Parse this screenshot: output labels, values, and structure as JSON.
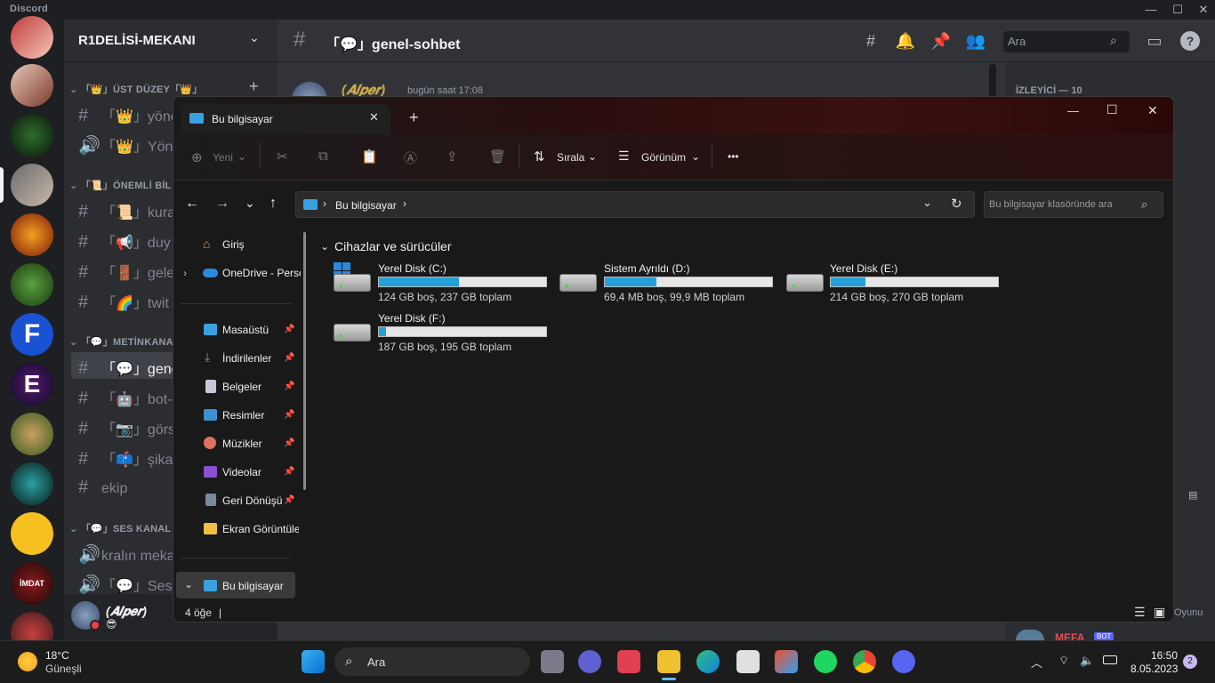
{
  "discord": {
    "brand": "Discord",
    "window_controls": {
      "minimize": "—",
      "maximize": "☐",
      "close": "✕"
    },
    "server_name": "R1DELİSİ-MEKANI",
    "categories": [
      {
        "label": "「👑」ÜST DÜZEY「👑」"
      },
      {
        "label": "「📜」ÖNEMLİ BİL"
      },
      {
        "label": "「💬」METİNKANA"
      },
      {
        "label": "「💬」SES KANAL"
      }
    ],
    "channels": [
      {
        "label": "「👑」yönet"
      },
      {
        "label": "「👑」Yönet"
      },
      {
        "label": "「📜」kura"
      },
      {
        "label": "「📢」duy"
      },
      {
        "label": "「🚪」gele"
      },
      {
        "label": "「🌈」twit"
      },
      {
        "label": "「💬」genel"
      },
      {
        "label": "「🤖」bot-"
      },
      {
        "label": "「📷」görs"
      },
      {
        "label": "「📫」şika"
      },
      {
        "label": "ekip"
      },
      {
        "label": "kralın meka"
      },
      {
        "label": "「💬」Ses"
      }
    ],
    "user": {
      "name": "(𝑨𝒍𝒑𝒆𝒓)",
      "status_emoji": "😎"
    },
    "chat": {
      "channel_title": "「💬」genel-sohbet",
      "search_placeholder": "Ara",
      "message_author": "(𝑨𝒍𝒑𝒆𝒓)",
      "message_time": "bugün saat 17:08"
    },
    "members": {
      "header": "İZLEYİCİ — 10",
      "partial_name": "MEFA",
      "bot_badge": "BOT",
      "partial_text": "Oyunu"
    }
  },
  "explorer": {
    "tab_title": "Bu bilgisayar",
    "new_tab": "+",
    "window_controls": {
      "minimize": "—",
      "maximize": "☐",
      "close": "✕"
    },
    "commands": {
      "new": "Yeni",
      "sort": "Sırala",
      "view": "Görünüm",
      "more": "•••"
    },
    "address": {
      "location": "Bu bilgisayar"
    },
    "search_placeholder": "Bu bilgisayar klasöründe ara",
    "nav": {
      "home": "Giriş",
      "onedrive": "OneDrive - Perso",
      "quick": [
        {
          "label": "Masaüstü"
        },
        {
          "label": "İndirilenler"
        },
        {
          "label": "Belgeler"
        },
        {
          "label": "Resimler"
        },
        {
          "label": "Müzikler"
        },
        {
          "label": "Videolar"
        },
        {
          "label": "Geri Dönüşüm"
        },
        {
          "label": "Ekran Görüntüle"
        }
      ],
      "this_pc": "Bu bilgisayar"
    },
    "section_title": "Cihazlar ve sürücüler",
    "drives": [
      {
        "name": "Yerel Disk (C:)",
        "info": "124 GB boş, 237 GB toplam",
        "used_fraction": 0.48
      },
      {
        "name": "Sistem Ayrıldı (D:)",
        "info": "69,4 MB boş, 99,9 MB toplam",
        "used_fraction": 0.31
      },
      {
        "name": "Yerel Disk (E:)",
        "info": "214 GB boş, 270 GB toplam",
        "used_fraction": 0.21
      },
      {
        "name": "Yerel Disk (F:)",
        "info": "187 GB boş, 195 GB toplam",
        "used_fraction": 0.04
      }
    ],
    "status": {
      "count": "4 öğe"
    }
  },
  "taskbar": {
    "weather": {
      "temp": "18°C",
      "condition": "Güneşli"
    },
    "search_label": "Ara",
    "clock": {
      "time": "16:50",
      "date": "8.05.2023"
    },
    "notification_count": "2"
  },
  "colors": {
    "accent": "#26a0da",
    "discord_bg": "#313338",
    "sidebar": "#2b2d31",
    "rail": "#1e1f22"
  }
}
